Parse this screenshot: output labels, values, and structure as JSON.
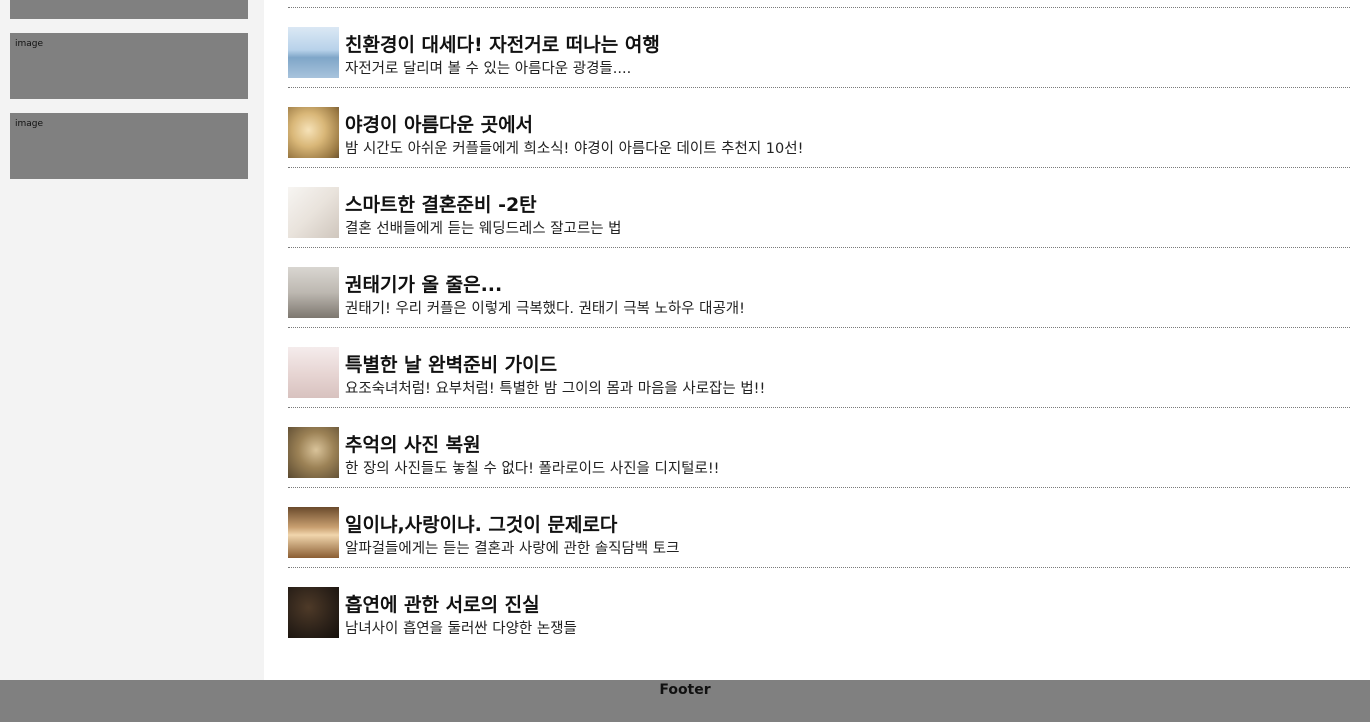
{
  "sidebar": {
    "ads": [
      {
        "label": ""
      },
      {
        "label": "image"
      },
      {
        "label": "image"
      }
    ]
  },
  "articles": [
    {
      "title": "친환경이 대세다! 자전거로 떠나는 여행",
      "desc": "자전거로 달리며 볼 수 있는 아름다운 광경들...."
    },
    {
      "title": "야경이 아름다운 곳에서",
      "desc": "밤 시간도 아쉬운 커플들에게 희소식! 야경이 아름다운 데이트 추천지 10선!"
    },
    {
      "title": "스마트한 결혼준비 -2탄",
      "desc": "결혼 선배들에게 듣는 웨딩드레스 잘고르는 법"
    },
    {
      "title": "권태기가 올 줄은...",
      "desc": "권태기! 우리 커플은 이렇게 극복했다. 권태기 극복 노하우 대공개!"
    },
    {
      "title": "특별한 날 완벽준비 가이드",
      "desc": "요조숙녀처럼! 요부처럼! 특별한 밤 그이의 몸과 마음을 사로잡는 법!!"
    },
    {
      "title": "추억의 사진 복원",
      "desc": "한 장의 사진들도 놓칠 수 없다! 폴라로이드 사진을 디지털로!!"
    },
    {
      "title": "일이냐,사랑이냐. 그것이 문제로다",
      "desc": "알파걸들에게는 듣는 결혼과 사랑에 관한 솔직담백 토크"
    },
    {
      "title": "흡연에 관한 서로의 진실",
      "desc": "남녀사이 흡연을 둘러싼 다양한 논쟁들"
    }
  ],
  "footer": {
    "label": "Footer"
  }
}
